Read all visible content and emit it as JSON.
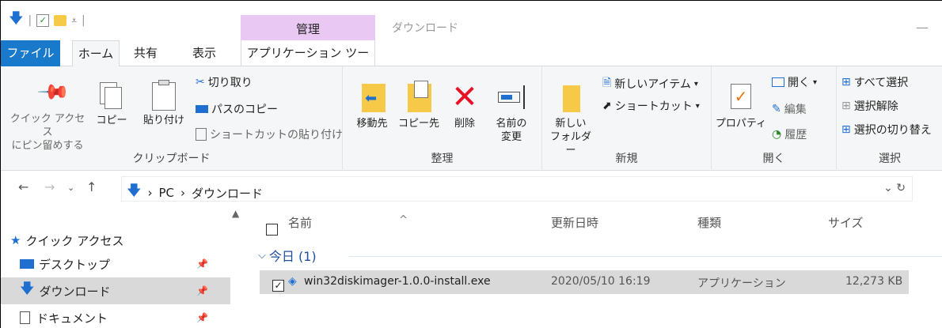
{
  "titlebar": {
    "context_group_label": "管理",
    "window_title": "ダウンロード",
    "minimize_glyph": "—"
  },
  "tabs": {
    "file": "ファイル",
    "home": "ホーム",
    "share": "共有",
    "view": "表示",
    "app_tools": "アプリケーション ツール"
  },
  "ribbon": {
    "clipboard": {
      "pin_label_line1": "クイック アクセス",
      "pin_label_line2": "にピン留めする",
      "copy": "コピー",
      "paste": "貼り付け",
      "cut": "切り取り",
      "copy_path": "パスのコピー",
      "paste_shortcut": "ショートカットの貼り付け",
      "group_label": "クリップボード"
    },
    "organize": {
      "move_to": "移動先",
      "copy_to": "コピー先",
      "delete": "削除",
      "rename_line1": "名前の",
      "rename_line2": "変更",
      "group_label": "整理"
    },
    "new": {
      "new_folder_line1": "新しい",
      "new_folder_line2": "フォルダー",
      "new_item": "新しいアイテム",
      "shortcut": "ショートカット",
      "group_label": "新規"
    },
    "open": {
      "properties": "プロパティ",
      "open": "開く",
      "edit": "編集",
      "history": "履歴",
      "group_label": "開く"
    },
    "select": {
      "select_all": "すべて選択",
      "select_none": "選択解除",
      "invert": "選択の切り替え",
      "group_label": "選択"
    }
  },
  "address": {
    "crumbs": [
      "PC",
      "ダウンロード"
    ],
    "separator": "›"
  },
  "nav": {
    "quick_access": "クイック アクセス",
    "items": [
      {
        "label": "デスクトップ"
      },
      {
        "label": "ダウンロード"
      },
      {
        "label": "ドキュメント"
      }
    ]
  },
  "columns": {
    "name": "名前",
    "modified": "更新日時",
    "type": "種類",
    "size": "サイズ"
  },
  "group": {
    "label": "今日 (1)"
  },
  "files": [
    {
      "name": "win32diskimager-1.0.0-install.exe",
      "modified": "2020/05/10 16:19",
      "type": "アプリケーション",
      "size": "12,273 KB"
    }
  ],
  "colors": {
    "file_tab": "#1979ca",
    "context_tab": "#e9c9f3",
    "delete_red": "#e81123",
    "folder_yellow": "#f7c948",
    "selection": "#d9d9d9"
  }
}
